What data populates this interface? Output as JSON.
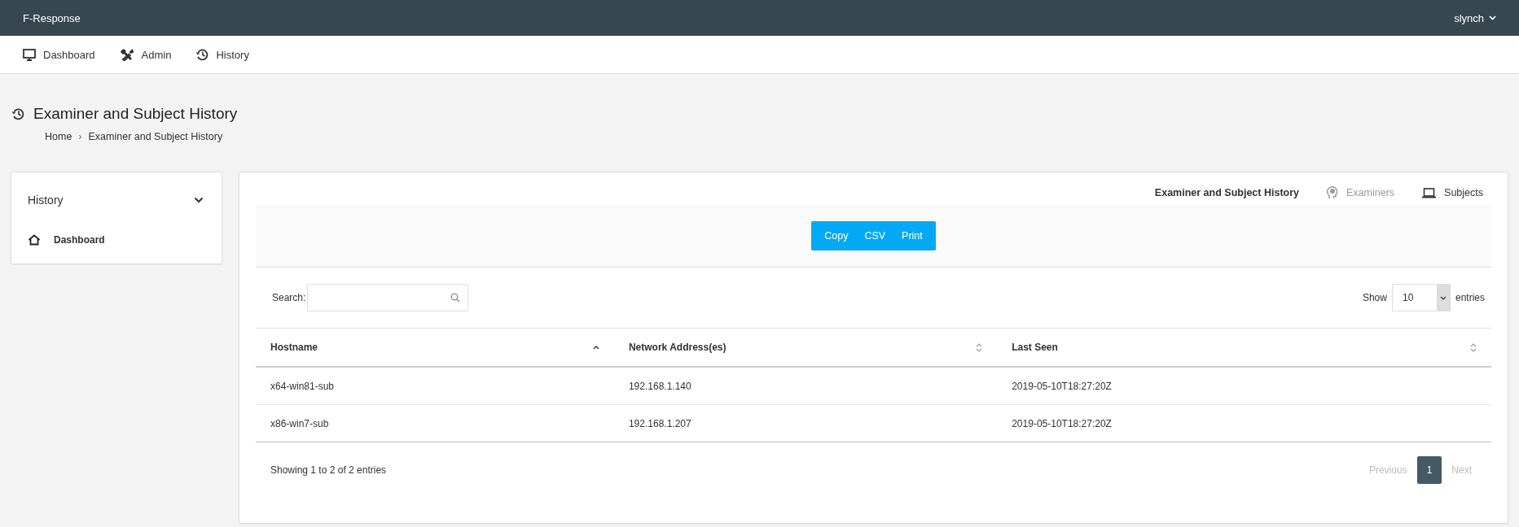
{
  "topbar": {
    "brand": "F-Response",
    "user": "slynch"
  },
  "nav": [
    {
      "label": "Dashboard",
      "kind": "monitor"
    },
    {
      "label": "Admin",
      "kind": "tools"
    },
    {
      "label": "History",
      "kind": "history"
    }
  ],
  "page": {
    "title": "Examiner and Subject History",
    "breadcrumb": [
      "Home",
      "›",
      "Examiner and Subject History"
    ]
  },
  "sidebar": {
    "title": "History",
    "expanded": true,
    "items": [
      {
        "label": "Dashboard",
        "kind": "home"
      }
    ]
  },
  "tabs": [
    {
      "label": "Examiner and Subject History",
      "selected": true,
      "disabled": false,
      "kind": "plain"
    },
    {
      "label": "Examiners",
      "selected": false,
      "disabled": true,
      "kind": "head"
    },
    {
      "label": "Subjects",
      "selected": false,
      "disabled": false,
      "kind": "laptop"
    }
  ],
  "export_buttons": [
    "Copy",
    "CSV",
    "Print"
  ],
  "search": {
    "label": "Search:"
  },
  "length": {
    "before": "Show",
    "value": "10",
    "after": "entries"
  },
  "table": {
    "columns": [
      {
        "label": "Hostname",
        "kind": "ascending"
      },
      {
        "label": "Network Address(es)",
        "kind": "sortable"
      },
      {
        "label": "Last Seen",
        "kind": "sortable"
      }
    ],
    "rows": [
      [
        "x64-win81-sub",
        "192.168.1.140",
        "2019-05-10T18:27:20Z"
      ],
      [
        "x86-win7-sub",
        "192.168.1.207",
        "2019-05-10T18:27:20Z"
      ]
    ]
  },
  "info": "Showing 1 to 2 of 2 entries",
  "pagination": {
    "previous": {
      "label": "Previous",
      "disabled": true
    },
    "pages": [
      {
        "label": "1",
        "selected": true
      }
    ],
    "next": {
      "label": "Next",
      "disabled": true
    }
  }
}
